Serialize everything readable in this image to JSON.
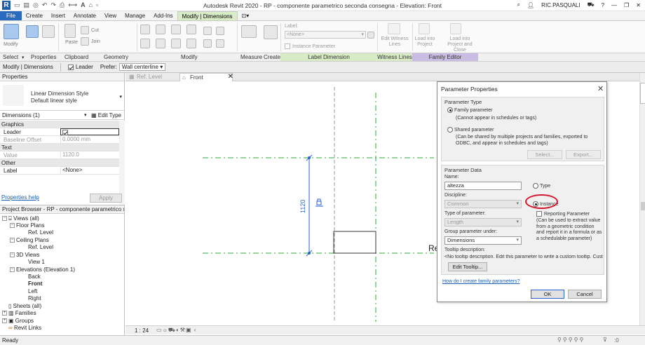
{
  "window": {
    "app_title": "Autodesk Revit 2020 - RP - componente parametrico seconda consegna - Elevation: Front",
    "user": "RIC.PASQUALI"
  },
  "ribbon": {
    "tabs": [
      "File",
      "Create",
      "Insert",
      "Annotate",
      "View",
      "Manage",
      "Add-Ins",
      "Modify | Dimensions"
    ],
    "active_tab": "Modify | Dimensions",
    "tools": {
      "modify": "Modify",
      "paste": "Paste",
      "cut": "Cut",
      "join": "Join",
      "label": "Label:",
      "label_value": "<None>",
      "instance_parameter": "Instance Parameter",
      "edit_witness_lines": "Edit Witness Lines",
      "load_into_project": "Load into Project",
      "load_into_project_close": "Load into Project and Close"
    },
    "panels": [
      "Select",
      "Properties",
      "Clipboard",
      "Geometry",
      "Modify",
      "Measure",
      "Create",
      "Label Dimension",
      "Witness Lines",
      "Family Editor"
    ],
    "colors": {
      "file_tab": "#2a6bc0",
      "context_tab": "#d8ecc6",
      "family_editor": "#c9bde3"
    }
  },
  "options_bar": {
    "context": "Modify | Dimensions",
    "leader_label": "Leader",
    "leader_checked": true,
    "prefer_label": "Prefer:",
    "prefer_value": "Wall centerline"
  },
  "properties": {
    "title": "Properties",
    "type_family": "Linear Dimension Style",
    "type_name": "Default linear style",
    "filter": "Dimensions (1)",
    "edit_type": "Edit Type",
    "groups": {
      "graphics": "Graphics",
      "text": "Text",
      "other": "Other"
    },
    "rows": {
      "leader_k": "Leader",
      "baseline_k": "Baseline Offset",
      "baseline_v": "0.0000 mm",
      "value_k": "Value",
      "value_v": "1120.0",
      "label_k": "Label",
      "label_v": "<None>"
    },
    "help_link": "Properties help",
    "apply": "Apply"
  },
  "browser": {
    "title": "Project Browser - RP - componente parametrico sec...",
    "nodes": {
      "views": "Views (all)",
      "floor_plans": "Floor Plans",
      "fp_ref": "Ref. Level",
      "ceiling_plans": "Ceiling Plans",
      "cp_ref": "Ref. Level",
      "views_3d": "3D Views",
      "view1": "View 1",
      "elevations": "Elevations (Elevation 1)",
      "back": "Back",
      "front": "Front",
      "left": "Left",
      "right": "Right",
      "sheets": "Sheets (all)",
      "families": "Families",
      "groups": "Groups",
      "revit_links": "Revit Links"
    }
  },
  "view_tabs": [
    "Ref. Level",
    "Front"
  ],
  "canvas": {
    "dimension_value": "1120",
    "ref_label": "Re"
  },
  "view_control": {
    "scale": "1 : 24"
  },
  "status": {
    "text": "Ready",
    "right_count": ":0"
  },
  "dialog": {
    "title": "Parameter Properties",
    "parameter_type_group": "Parameter Type",
    "family_parameter": "Family parameter",
    "family_parameter_desc": "(Cannot appear in schedules or tags)",
    "shared_parameter": "Shared parameter",
    "shared_parameter_desc": "(Can be shared by multiple projects and families, exported to ODBC, and appear in schedules and tags)",
    "select_btn": "Select...",
    "export_btn": "Export...",
    "parameter_data_group": "Parameter Data",
    "name_label": "Name:",
    "name_value": "altezza",
    "type_option": "Type",
    "instance_option": "Instance",
    "discipline_label": "Discipline:",
    "discipline_value": "Common",
    "type_of_param_label": "Type of parameter:",
    "type_of_param_value": "Length",
    "reporting_parameter": "Reporting Parameter",
    "reporting_desc": "(Can be used to extract value from a geometric condition and report it in a formula or as a schedulable parameter)",
    "group_under_label": "Group parameter under:",
    "group_under_value": "Dimensions",
    "tooltip_label": "Tooltip description:",
    "tooltip_value": "<No tooltip description. Edit this parameter to write a custom tooltip. Custom ...",
    "edit_tooltip_btn": "Edit Tooltip...",
    "help_link": "How do I create family parameters?",
    "ok_btn": "OK",
    "cancel_btn": "Cancel",
    "highlight_color": "#d5132a"
  }
}
